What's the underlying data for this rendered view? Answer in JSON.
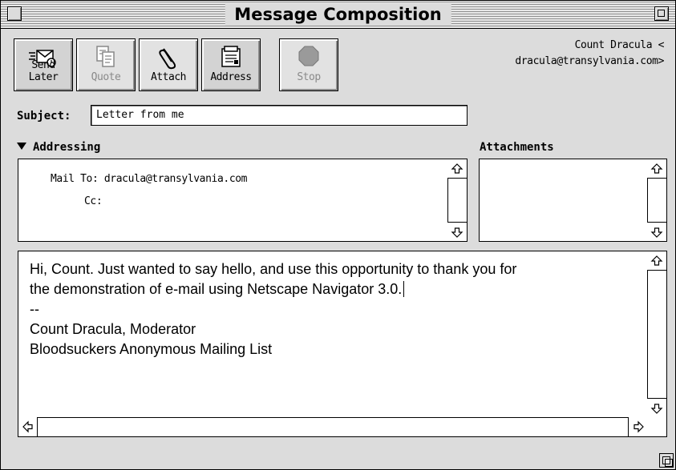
{
  "window": {
    "title": "Message Composition"
  },
  "toolbar": {
    "buttons": [
      {
        "label": "Send Later",
        "icon": "send-later-icon",
        "enabled": true
      },
      {
        "label": "Quote",
        "icon": "quote-icon",
        "enabled": false
      },
      {
        "label": "Attach",
        "icon": "paperclip-icon",
        "enabled": true
      },
      {
        "label": "Address",
        "icon": "address-book-icon",
        "enabled": true
      },
      {
        "label": "Stop",
        "icon": "stop-icon",
        "enabled": false
      }
    ]
  },
  "sender": {
    "name_line": "Count Dracula <",
    "email_line": "dracula@transylvania.com>"
  },
  "subject": {
    "label": "Subject:",
    "value": "Letter from me"
  },
  "addressing": {
    "label": "Addressing",
    "expanded": true,
    "mail_to_label": "Mail To:",
    "mail_to_value": "dracula@transylvania.com",
    "cc_label": "Cc:",
    "cc_value": ""
  },
  "attachments": {
    "label": "Attachments"
  },
  "body": {
    "lines": [
      "Hi, Count. Just wanted to say hello, and use this opportunity to thank you for",
      "the demonstration of e-mail using Netscape Navigator 3.0.",
      "--",
      "Count Dracula, Moderator",
      "Bloodsuckers Anonymous Mailing List"
    ]
  }
}
